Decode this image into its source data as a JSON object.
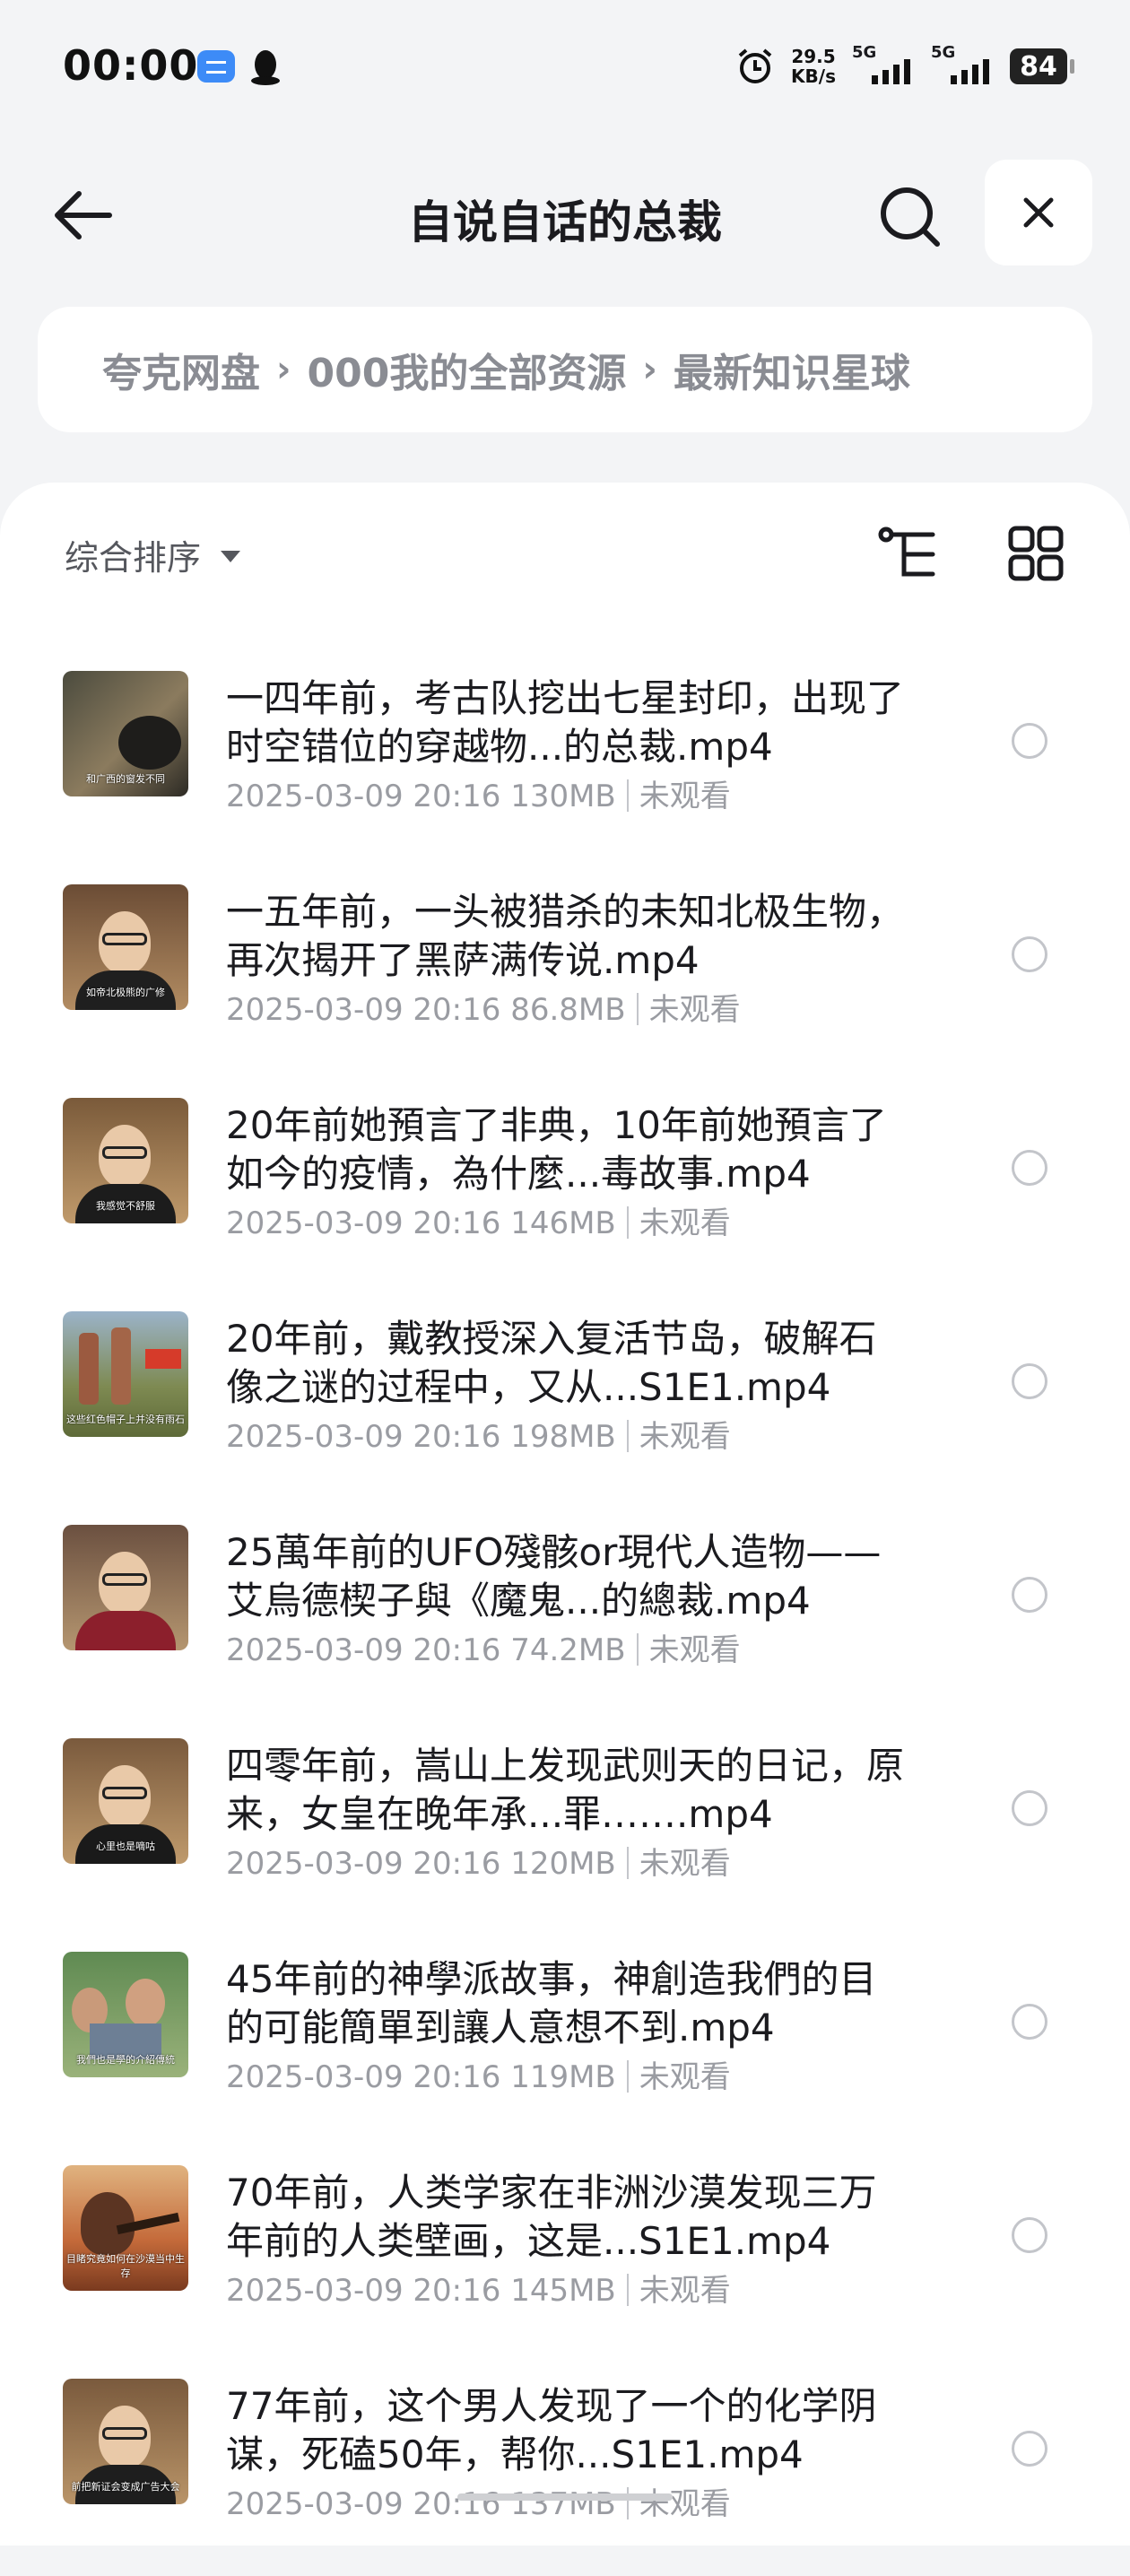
{
  "status": {
    "time": "00:00",
    "net_speed_value": "29.5",
    "net_speed_unit": "KB/s",
    "sim1": "5G",
    "sim2": "5G",
    "battery": "84"
  },
  "header": {
    "title": "自说自话的总裁"
  },
  "breadcrumb": {
    "items": [
      "夸克网盘",
      "000我的全部资源",
      "最新知识星球"
    ]
  },
  "toolbar": {
    "sort_label": "综合排序"
  },
  "files": [
    {
      "name": "一四年前，考古队挖出七星封印，出现了时空错位的穿越物...的总裁.mp4",
      "date": "2025-03-09 20:16",
      "size": "130MB",
      "status": "未观看",
      "thumb_caption": "和广西的窗发不同"
    },
    {
      "name": "一五年前，一头被猎杀的未知北极生物，再次揭开了黑萨满传说.mp4",
      "date": "2025-03-09 20:16",
      "size": "86.8MB",
      "status": "未观看",
      "thumb_caption": "如帝北极熊的广修"
    },
    {
      "name": "20年前她預言了非典，10年前她預言了如今的疫情，為什麼...毒故事.mp4",
      "date": "2025-03-09 20:16",
      "size": "146MB",
      "status": "未观看",
      "thumb_caption": "我感觉不舒服"
    },
    {
      "name": "20年前，戴教授深入复活节岛，破解石像之谜的过程中，又从...S1E1.mp4",
      "date": "2025-03-09 20:16",
      "size": "198MB",
      "status": "未观看",
      "thumb_caption": "这些红色帽子上并没有雨石"
    },
    {
      "name": "25萬年前的UFO殘骸or現代人造物——艾烏德楔子與《魔鬼...的總裁.mp4",
      "date": "2025-03-09 20:16",
      "size": "74.2MB",
      "status": "未观看",
      "thumb_caption": ""
    },
    {
      "name": "四零年前，嵩山上发现武则天的日记，原来，女皇在晚年承...罪…….mp4",
      "date": "2025-03-09 20:16",
      "size": "120MB",
      "status": "未观看",
      "thumb_caption": "心里也是嘀咕"
    },
    {
      "name": "45年前的神學派故事，神創造我們的目的可能簡單到讓人意想不到.mp4",
      "date": "2025-03-09 20:16",
      "size": "119MB",
      "status": "未观看",
      "thumb_caption": "我們也是學的介紹傳統"
    },
    {
      "name": "70年前，人类学家在非洲沙漠发现三万年前的人类壁画，这是...S1E1.mp4",
      "date": "2025-03-09 20:16",
      "size": "145MB",
      "status": "未观看",
      "thumb_caption": "目睹究竟如何在沙漠当中生存"
    },
    {
      "name": "77年前，这个男人发现了一个的化学阴谋，死磕50年，帮你...S1E1.mp4",
      "date": "2025-03-09 20:16",
      "size": "137MB",
      "status": "未观看",
      "thumb_caption": "前把新证会变成广告大会"
    }
  ],
  "colors": {
    "background": "#f3f4f6",
    "card": "#ffffff",
    "text_primary": "#1b1b1f",
    "text_secondary": "#9a9ca2"
  }
}
